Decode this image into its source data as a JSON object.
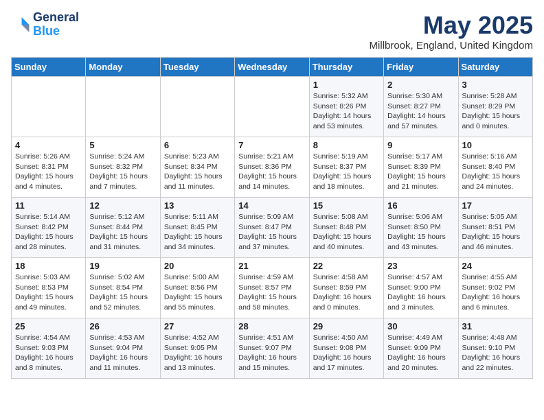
{
  "header": {
    "logo_line1": "General",
    "logo_line2": "Blue",
    "month": "May 2025",
    "location": "Millbrook, England, United Kingdom"
  },
  "days_of_week": [
    "Sunday",
    "Monday",
    "Tuesday",
    "Wednesday",
    "Thursday",
    "Friday",
    "Saturday"
  ],
  "weeks": [
    [
      {
        "day": "",
        "info": ""
      },
      {
        "day": "",
        "info": ""
      },
      {
        "day": "",
        "info": ""
      },
      {
        "day": "",
        "info": ""
      },
      {
        "day": "1",
        "info": "Sunrise: 5:32 AM\nSunset: 8:26 PM\nDaylight: 14 hours\nand 53 minutes."
      },
      {
        "day": "2",
        "info": "Sunrise: 5:30 AM\nSunset: 8:27 PM\nDaylight: 14 hours\nand 57 minutes."
      },
      {
        "day": "3",
        "info": "Sunrise: 5:28 AM\nSunset: 8:29 PM\nDaylight: 15 hours\nand 0 minutes."
      }
    ],
    [
      {
        "day": "4",
        "info": "Sunrise: 5:26 AM\nSunset: 8:31 PM\nDaylight: 15 hours\nand 4 minutes."
      },
      {
        "day": "5",
        "info": "Sunrise: 5:24 AM\nSunset: 8:32 PM\nDaylight: 15 hours\nand 7 minutes."
      },
      {
        "day": "6",
        "info": "Sunrise: 5:23 AM\nSunset: 8:34 PM\nDaylight: 15 hours\nand 11 minutes."
      },
      {
        "day": "7",
        "info": "Sunrise: 5:21 AM\nSunset: 8:36 PM\nDaylight: 15 hours\nand 14 minutes."
      },
      {
        "day": "8",
        "info": "Sunrise: 5:19 AM\nSunset: 8:37 PM\nDaylight: 15 hours\nand 18 minutes."
      },
      {
        "day": "9",
        "info": "Sunrise: 5:17 AM\nSunset: 8:39 PM\nDaylight: 15 hours\nand 21 minutes."
      },
      {
        "day": "10",
        "info": "Sunrise: 5:16 AM\nSunset: 8:40 PM\nDaylight: 15 hours\nand 24 minutes."
      }
    ],
    [
      {
        "day": "11",
        "info": "Sunrise: 5:14 AM\nSunset: 8:42 PM\nDaylight: 15 hours\nand 28 minutes."
      },
      {
        "day": "12",
        "info": "Sunrise: 5:12 AM\nSunset: 8:44 PM\nDaylight: 15 hours\nand 31 minutes."
      },
      {
        "day": "13",
        "info": "Sunrise: 5:11 AM\nSunset: 8:45 PM\nDaylight: 15 hours\nand 34 minutes."
      },
      {
        "day": "14",
        "info": "Sunrise: 5:09 AM\nSunset: 8:47 PM\nDaylight: 15 hours\nand 37 minutes."
      },
      {
        "day": "15",
        "info": "Sunrise: 5:08 AM\nSunset: 8:48 PM\nDaylight: 15 hours\nand 40 minutes."
      },
      {
        "day": "16",
        "info": "Sunrise: 5:06 AM\nSunset: 8:50 PM\nDaylight: 15 hours\nand 43 minutes."
      },
      {
        "day": "17",
        "info": "Sunrise: 5:05 AM\nSunset: 8:51 PM\nDaylight: 15 hours\nand 46 minutes."
      }
    ],
    [
      {
        "day": "18",
        "info": "Sunrise: 5:03 AM\nSunset: 8:53 PM\nDaylight: 15 hours\nand 49 minutes."
      },
      {
        "day": "19",
        "info": "Sunrise: 5:02 AM\nSunset: 8:54 PM\nDaylight: 15 hours\nand 52 minutes."
      },
      {
        "day": "20",
        "info": "Sunrise: 5:00 AM\nSunset: 8:56 PM\nDaylight: 15 hours\nand 55 minutes."
      },
      {
        "day": "21",
        "info": "Sunrise: 4:59 AM\nSunset: 8:57 PM\nDaylight: 15 hours\nand 58 minutes."
      },
      {
        "day": "22",
        "info": "Sunrise: 4:58 AM\nSunset: 8:59 PM\nDaylight: 16 hours\nand 0 minutes."
      },
      {
        "day": "23",
        "info": "Sunrise: 4:57 AM\nSunset: 9:00 PM\nDaylight: 16 hours\nand 3 minutes."
      },
      {
        "day": "24",
        "info": "Sunrise: 4:55 AM\nSunset: 9:02 PM\nDaylight: 16 hours\nand 6 minutes."
      }
    ],
    [
      {
        "day": "25",
        "info": "Sunrise: 4:54 AM\nSunset: 9:03 PM\nDaylight: 16 hours\nand 8 minutes."
      },
      {
        "day": "26",
        "info": "Sunrise: 4:53 AM\nSunset: 9:04 PM\nDaylight: 16 hours\nand 11 minutes."
      },
      {
        "day": "27",
        "info": "Sunrise: 4:52 AM\nSunset: 9:05 PM\nDaylight: 16 hours\nand 13 minutes."
      },
      {
        "day": "28",
        "info": "Sunrise: 4:51 AM\nSunset: 9:07 PM\nDaylight: 16 hours\nand 15 minutes."
      },
      {
        "day": "29",
        "info": "Sunrise: 4:50 AM\nSunset: 9:08 PM\nDaylight: 16 hours\nand 17 minutes."
      },
      {
        "day": "30",
        "info": "Sunrise: 4:49 AM\nSunset: 9:09 PM\nDaylight: 16 hours\nand 20 minutes."
      },
      {
        "day": "31",
        "info": "Sunrise: 4:48 AM\nSunset: 9:10 PM\nDaylight: 16 hours\nand 22 minutes."
      }
    ]
  ]
}
